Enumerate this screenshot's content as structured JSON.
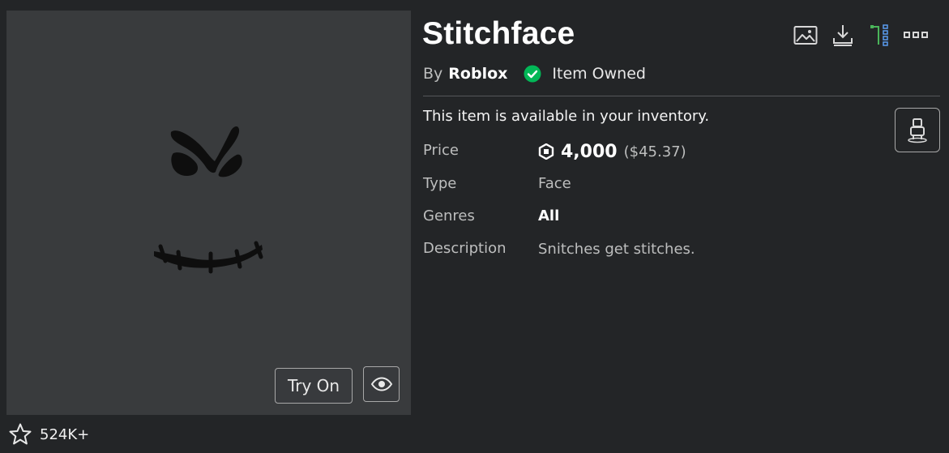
{
  "item": {
    "title": "Stitchface",
    "by_label": "By",
    "creator": "Roblox",
    "owned_text": "Item Owned",
    "availability_text": "This item is available in your inventory."
  },
  "details": {
    "price_label": "Price",
    "price_amount": "4,000",
    "price_usd": "($45.37)",
    "type_label": "Type",
    "type_value": "Face",
    "genres_label": "Genres",
    "genres_value": "All",
    "description_label": "Description",
    "description_value": "Snitches get stitches."
  },
  "thumbnail": {
    "try_on_label": "Try On",
    "favorites_count": "524K+"
  },
  "toolbar": {
    "icons": [
      "image-icon",
      "download-icon",
      "hierarchy-icon",
      "more-icon"
    ]
  },
  "colors": {
    "background": "#232527",
    "thumbnail_bg": "#393b3d",
    "owned_green": "#02b757",
    "muted_text": "#bdbebe"
  }
}
